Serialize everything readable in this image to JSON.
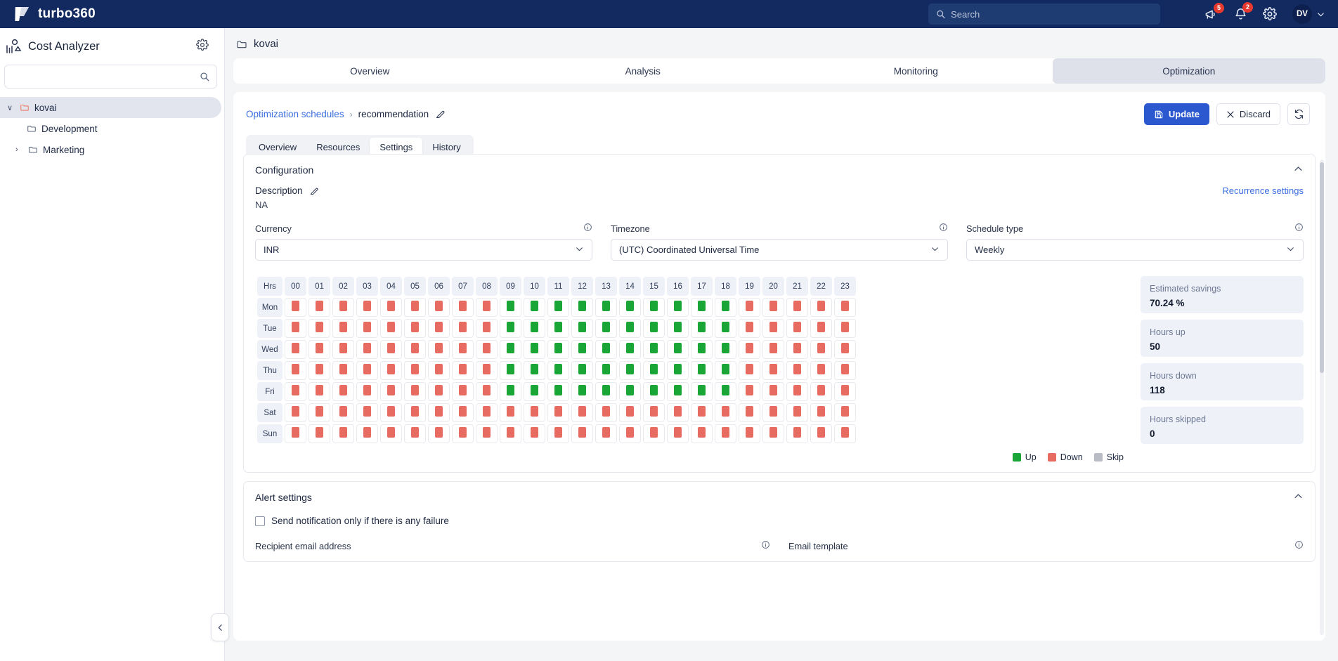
{
  "topbar": {
    "brand": "turbo360",
    "search_placeholder": "Search",
    "search_value": "",
    "announcements_badge": "5",
    "notifications_badge": "2",
    "user_initials": "DV"
  },
  "sidebar": {
    "title": "Cost Analyzer",
    "search_placeholder": "",
    "search_value": "",
    "items": [
      {
        "label": "kovai",
        "depth": 0,
        "caret": "∨",
        "active": true
      },
      {
        "label": "Development",
        "depth": 1,
        "caret": "",
        "active": false
      },
      {
        "label": "Marketing",
        "depth": 1,
        "caret": "›",
        "active": false
      }
    ]
  },
  "breadcrumb_top": {
    "label": "kovai"
  },
  "top_tabs": [
    {
      "label": "Overview",
      "active": false
    },
    {
      "label": "Analysis",
      "active": false
    },
    {
      "label": "Monitoring",
      "active": false
    },
    {
      "label": "Optimization",
      "active": true
    }
  ],
  "panel": {
    "breadcrumb_link": "Optimization schedules",
    "breadcrumb_separator": "›",
    "breadcrumb_current": "recommendation",
    "update_label": "Update",
    "discard_label": "Discard",
    "sub_tabs": [
      {
        "label": "Overview",
        "active": false
      },
      {
        "label": "Resources",
        "active": false
      },
      {
        "label": "Settings",
        "active": true
      },
      {
        "label": "History",
        "active": false
      }
    ]
  },
  "configuration": {
    "title": "Configuration",
    "description_label": "Description",
    "description_value": "NA",
    "recurrence_link": "Recurrence settings",
    "currency": {
      "label": "Currency",
      "value": "INR"
    },
    "timezone": {
      "label": "Timezone",
      "value": "(UTC) Coordinated Universal Time"
    },
    "schedule_type": {
      "label": "Schedule type",
      "value": "Weekly"
    }
  },
  "schedule": {
    "hrs_header": "Hrs",
    "hours": [
      "00",
      "01",
      "02",
      "03",
      "04",
      "05",
      "06",
      "07",
      "08",
      "09",
      "10",
      "11",
      "12",
      "13",
      "14",
      "15",
      "16",
      "17",
      "18",
      "19",
      "20",
      "21",
      "22",
      "23"
    ],
    "days": [
      "Mon",
      "Tue",
      "Wed",
      "Thu",
      "Fri",
      "Sat",
      "Sun"
    ],
    "states": {
      "Mon": [
        "down",
        "down",
        "down",
        "down",
        "down",
        "down",
        "down",
        "down",
        "down",
        "up",
        "up",
        "up",
        "up",
        "up",
        "up",
        "up",
        "up",
        "up",
        "up",
        "down",
        "down",
        "down",
        "down",
        "down"
      ],
      "Tue": [
        "down",
        "down",
        "down",
        "down",
        "down",
        "down",
        "down",
        "down",
        "down",
        "up",
        "up",
        "up",
        "up",
        "up",
        "up",
        "up",
        "up",
        "up",
        "up",
        "down",
        "down",
        "down",
        "down",
        "down"
      ],
      "Wed": [
        "down",
        "down",
        "down",
        "down",
        "down",
        "down",
        "down",
        "down",
        "down",
        "up",
        "up",
        "up",
        "up",
        "up",
        "up",
        "up",
        "up",
        "up",
        "up",
        "down",
        "down",
        "down",
        "down",
        "down"
      ],
      "Thu": [
        "down",
        "down",
        "down",
        "down",
        "down",
        "down",
        "down",
        "down",
        "down",
        "up",
        "up",
        "up",
        "up",
        "up",
        "up",
        "up",
        "up",
        "up",
        "up",
        "down",
        "down",
        "down",
        "down",
        "down"
      ],
      "Fri": [
        "down",
        "down",
        "down",
        "down",
        "down",
        "down",
        "down",
        "down",
        "down",
        "up",
        "up",
        "up",
        "up",
        "up",
        "up",
        "up",
        "up",
        "up",
        "up",
        "down",
        "down",
        "down",
        "down",
        "down"
      ],
      "Sat": [
        "down",
        "down",
        "down",
        "down",
        "down",
        "down",
        "down",
        "down",
        "down",
        "down",
        "down",
        "down",
        "down",
        "down",
        "down",
        "down",
        "down",
        "down",
        "down",
        "down",
        "down",
        "down",
        "down",
        "down"
      ],
      "Sun": [
        "down",
        "down",
        "down",
        "down",
        "down",
        "down",
        "down",
        "down",
        "down",
        "down",
        "down",
        "down",
        "down",
        "down",
        "down",
        "down",
        "down",
        "down",
        "down",
        "down",
        "down",
        "down",
        "down",
        "down"
      ]
    },
    "legend": [
      {
        "label": "Up",
        "color": "#1aa636"
      },
      {
        "label": "Down",
        "color": "#e86b62"
      },
      {
        "label": "Skip",
        "color": "#b9bcc4"
      }
    ]
  },
  "metrics": [
    {
      "label": "Estimated savings",
      "value": "70.24 %"
    },
    {
      "label": "Hours up",
      "value": "50"
    },
    {
      "label": "Hours down",
      "value": "118"
    },
    {
      "label": "Hours skipped",
      "value": "0"
    }
  ],
  "alert_settings": {
    "title": "Alert settings",
    "checkbox_label": "Send notification only if there is any failure",
    "checked": false,
    "recipient_label": "Recipient email address",
    "email_template_label": "Email template"
  },
  "colors": {
    "brand_navy": "#122a5f",
    "primary_blue": "#2b58cf",
    "link_blue": "#3b6fe0",
    "up_green": "#1aa636",
    "down_red": "#e86b62",
    "skip_gray": "#b9bcc4",
    "badge_red": "#e8392f"
  }
}
